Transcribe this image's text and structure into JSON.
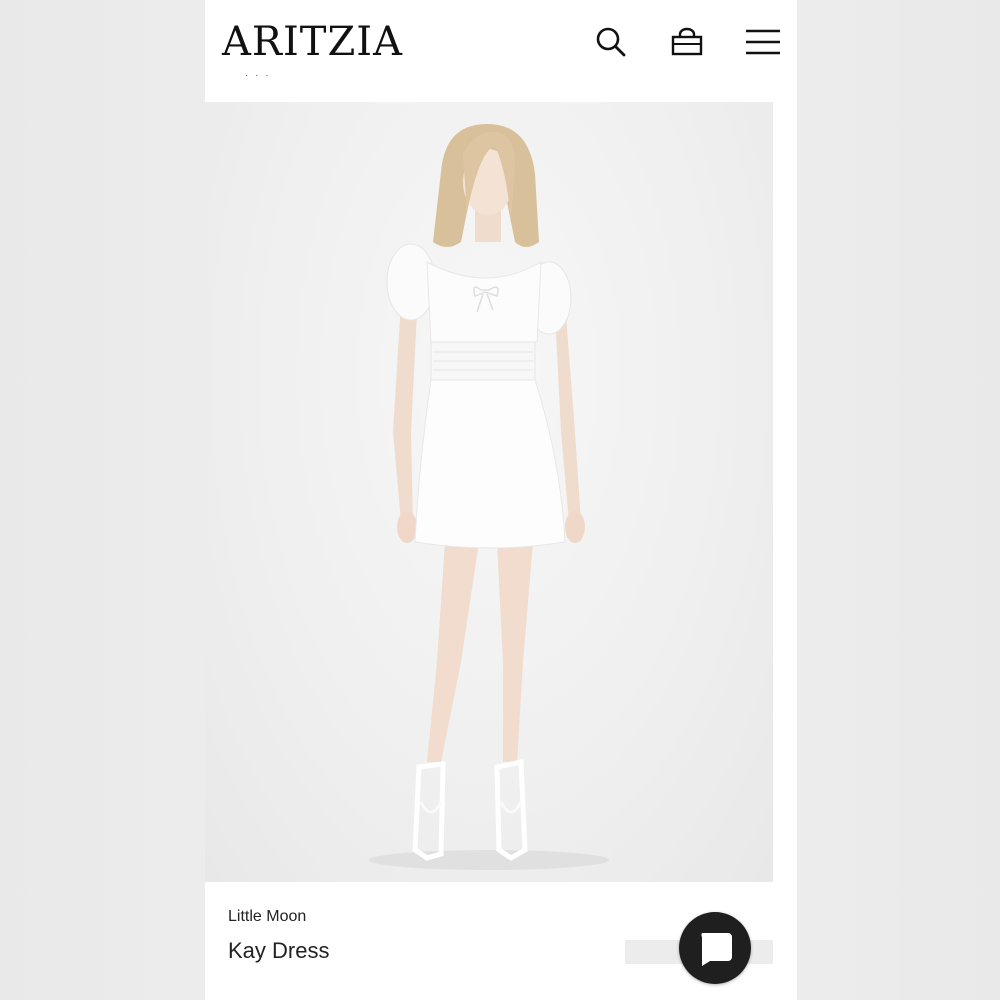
{
  "header": {
    "logo": "ARITZIA",
    "icons": [
      "search-icon",
      "bag-icon",
      "menu-icon"
    ],
    "breadcrumb": "·  ·  ·"
  },
  "product": {
    "brand": "Little Moon",
    "name": "Kay Dress",
    "image": "white-mini-dress-model"
  },
  "chat": {
    "icon": "chat-bubble-icon"
  },
  "colors": {
    "text": "#111111",
    "page_bg": "#efefef",
    "chat_button": "#1f1f1f"
  }
}
